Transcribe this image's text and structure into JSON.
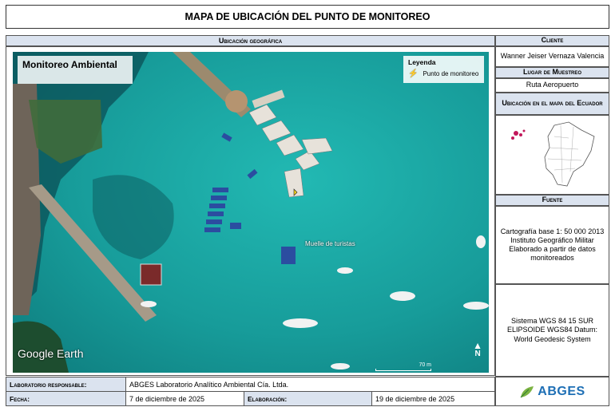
{
  "title": "MAPA DE UBICACIÓN DEL PUNTO DE MONITOREO",
  "map": {
    "header": "Ubicación geográfica",
    "overlay_title": "Monitoreo Ambiental",
    "legend_title": "Leyenda",
    "legend_item": "Punto de monitoreo",
    "point_label": "Muelle de turistas",
    "watermark": "Google Earth",
    "scale_label": "70 m",
    "north_label": "N"
  },
  "cliente": {
    "header": "Cliente",
    "value": "Wanner Jeiser Vernaza Valencia"
  },
  "lugar": {
    "header": "Lugar de Muestreo",
    "value": "Ruta Aeropuerto"
  },
  "ubicacion_ecuador": {
    "header": "Ubicación en el mapa del Ecuador"
  },
  "fuente": {
    "header": "Fuente",
    "text": "Cartografía base 1: 50 000 2013 Instituto Geográfico Militar Elaborado a partir de datos monitoreados"
  },
  "sistema": {
    "text": "Sistema WGS 84 15 SUR ELIPSOIDE WGS84 Datum: World Geodesic System"
  },
  "footer": {
    "lab_label": "Laboratorio responsable:",
    "lab_value": "ABGES Laboratorio Analítico Ambiental Cía. Ltda.",
    "fecha_label": "Fecha:",
    "fecha_value": "7 de diciembre de 2025",
    "elaboracion_label": "Elaboración:",
    "elaboracion_value": "19 de diciembre de 2025"
  },
  "logo": {
    "text": "ABGES"
  },
  "colors": {
    "header_bg": "#dbe3ef",
    "sea": "#1aa9a5",
    "logo_green": "#7cb342",
    "logo_blue": "#1e6fb5"
  }
}
